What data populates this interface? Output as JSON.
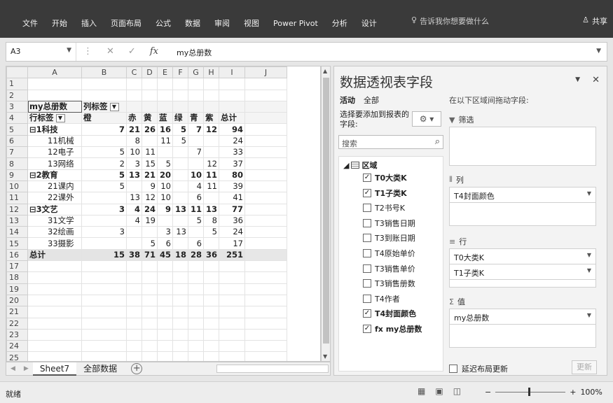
{
  "ribbon": {
    "tabs": [
      "文件",
      "开始",
      "插入",
      "页面布局",
      "公式",
      "数据",
      "审阅",
      "视图",
      "Power Pivot",
      "分析",
      "设计"
    ],
    "tellme": "告诉我你想要做什么",
    "share": "共享"
  },
  "formula_bar": {
    "cell_ref": "A3",
    "content": "my总册数"
  },
  "columns": [
    "A",
    "B",
    "C",
    "D",
    "E",
    "F",
    "G",
    "H",
    "I",
    "J"
  ],
  "rows": [
    [
      "1",
      "",
      "",
      "",
      "",
      "",
      "",
      "",
      "",
      "",
      ""
    ],
    [
      "2",
      "",
      "",
      "",
      "",
      "",
      "",
      "",
      "",
      "",
      ""
    ],
    [
      "3",
      "my总册数",
      "列标签",
      "",
      "",
      "",
      "",
      "",
      "",
      "",
      ""
    ],
    [
      "4",
      "行标签",
      "橙",
      "赤",
      "黄",
      "蓝",
      "绿",
      "青",
      "紫",
      "总计",
      ""
    ],
    [
      "5",
      "⊟1科技",
      "7",
      "21",
      "26",
      "16",
      "5",
      "7",
      "12",
      "94",
      ""
    ],
    [
      "6",
      "11机械",
      "",
      "8",
      "",
      "11",
      "5",
      "",
      "",
      "24",
      ""
    ],
    [
      "7",
      "12电子",
      "5",
      "10",
      "11",
      "",
      "",
      "7",
      "",
      "33",
      ""
    ],
    [
      "8",
      "13网络",
      "2",
      "3",
      "15",
      "5",
      "",
      "",
      "12",
      "37",
      ""
    ],
    [
      "9",
      "⊟2教育",
      "5",
      "13",
      "21",
      "20",
      "",
      "10",
      "11",
      "80",
      ""
    ],
    [
      "10",
      "21课内",
      "5",
      "",
      "9",
      "10",
      "",
      "4",
      "11",
      "39",
      ""
    ],
    [
      "11",
      "22课外",
      "",
      "13",
      "12",
      "10",
      "",
      "6",
      "",
      "41",
      ""
    ],
    [
      "12",
      "⊟3文艺",
      "3",
      "4",
      "24",
      "9",
      "13",
      "11",
      "13",
      "77",
      ""
    ],
    [
      "13",
      "31文学",
      "",
      "4",
      "19",
      "",
      "",
      "5",
      "8",
      "36",
      ""
    ],
    [
      "14",
      "32绘画",
      "3",
      "",
      "",
      "3",
      "13",
      "",
      "5",
      "24",
      ""
    ],
    [
      "15",
      "33摄影",
      "",
      "",
      "5",
      "6",
      "",
      "6",
      "",
      "17",
      ""
    ],
    [
      "16",
      "总计",
      "15",
      "38",
      "71",
      "45",
      "18",
      "28",
      "36",
      "251",
      ""
    ],
    [
      "17",
      "",
      "",
      "",
      "",
      "",
      "",
      "",
      "",
      "",
      ""
    ],
    [
      "18",
      "",
      "",
      "",
      "",
      "",
      "",
      "",
      "",
      "",
      ""
    ],
    [
      "19",
      "",
      "",
      "",
      "",
      "",
      "",
      "",
      "",
      "",
      ""
    ],
    [
      "20",
      "",
      "",
      "",
      "",
      "",
      "",
      "",
      "",
      "",
      ""
    ],
    [
      "21",
      "",
      "",
      "",
      "",
      "",
      "",
      "",
      "",
      "",
      ""
    ],
    [
      "22",
      "",
      "",
      "",
      "",
      "",
      "",
      "",
      "",
      "",
      ""
    ],
    [
      "23",
      "",
      "",
      "",
      "",
      "",
      "",
      "",
      "",
      "",
      ""
    ],
    [
      "24",
      "",
      "",
      "",
      "",
      "",
      "",
      "",
      "",
      "",
      ""
    ],
    [
      "25",
      "",
      "",
      "",
      "",
      "",
      "",
      "",
      "",
      "",
      ""
    ]
  ],
  "sheet_tabs": [
    "Sheet7",
    "全部数据"
  ],
  "panel": {
    "title": "数据透视表字段",
    "tab_active": "活动",
    "tab_all": "全部",
    "choose_label": "选择要添加到报表的字段:",
    "search_placeholder": "搜索",
    "area_name": "区域",
    "fields": [
      {
        "name": "T0大类K",
        "checked": true
      },
      {
        "name": "T1子类K",
        "checked": true
      },
      {
        "name": "T2书号K",
        "checked": false
      },
      {
        "name": "T3销售日期",
        "checked": false
      },
      {
        "name": "T3到账日期",
        "checked": false
      },
      {
        "name": "T4原始单价",
        "checked": false
      },
      {
        "name": "T3销售单价",
        "checked": false
      },
      {
        "name": "T3销售册数",
        "checked": false
      },
      {
        "name": "T4作者",
        "checked": false
      },
      {
        "name": "T4封面颜色",
        "checked": true
      },
      {
        "name": "fx my总册数",
        "checked": true
      }
    ],
    "drag_hint": "在以下区域间拖动字段:",
    "filter_label": "筛选",
    "columns_label": "列",
    "columns_fields": [
      "T4封面颜色"
    ],
    "rows_label": "行",
    "rows_fields": [
      "T0大类K",
      "T1子类K"
    ],
    "values_label": "值",
    "values_fields": [
      "my总册数"
    ],
    "defer_label": "延迟布局更新",
    "update_label": "更新"
  },
  "status": {
    "ready": "就绪",
    "zoom": "100%"
  }
}
